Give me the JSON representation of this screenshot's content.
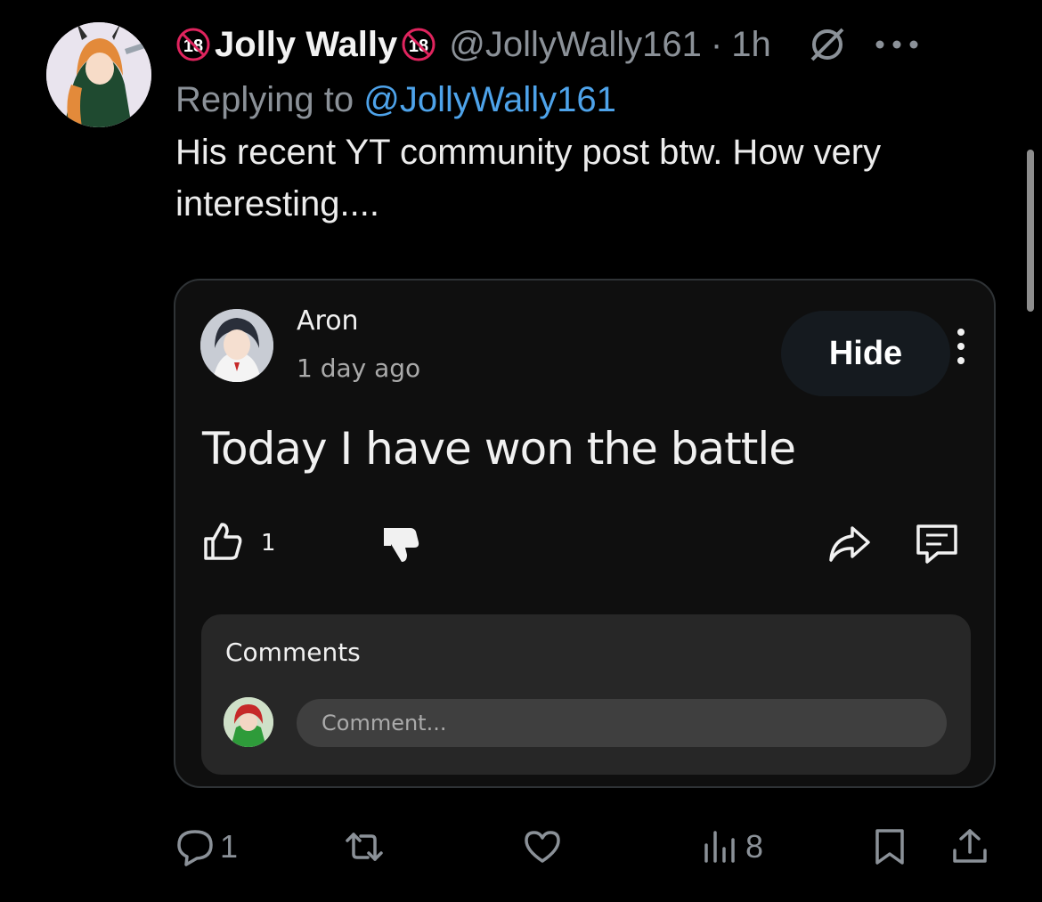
{
  "tweet": {
    "badge": "18",
    "display_name": "Jolly Wally",
    "handle": "@JollyWally161",
    "separator": "·",
    "time": "1h",
    "replying_prefix": "Replying to ",
    "replying_handle": "@JollyWally161",
    "text": "His recent YT community post btw. How very interesting...."
  },
  "embedded_post": {
    "author": "Aron",
    "time": "1 day ago",
    "hide_label": "Hide",
    "text": "Today I have won the battle",
    "like_count": "1",
    "comments_title": "Comments",
    "comment_placeholder": "Comment..."
  },
  "actions": {
    "replies": "1",
    "views": "8"
  },
  "colors": {
    "background": "#000000",
    "mention_blue": "#4ea3ea",
    "muted_gray": "#8b9198",
    "badge_red": "#e0245e",
    "card_bg": "#0f0f0f"
  }
}
